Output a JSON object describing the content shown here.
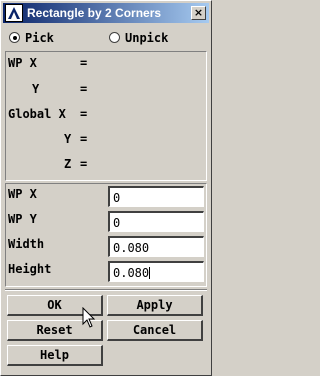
{
  "window": {
    "title": "Rectangle by 2 Corners",
    "close_glyph": "×"
  },
  "pick_mode": {
    "options": [
      "Pick",
      "Unpick"
    ],
    "selected": "Pick"
  },
  "readouts": [
    {
      "label": "WP X",
      "sep": "="
    },
    {
      "label": "Y",
      "sep": "="
    },
    {
      "label": "Global X",
      "sep": "="
    },
    {
      "label": "Y",
      "sep": "="
    },
    {
      "label": "Z",
      "sep": "="
    }
  ],
  "fields": [
    {
      "label": "WP X",
      "value": "0"
    },
    {
      "label": "WP Y",
      "value": "0"
    },
    {
      "label": "Width",
      "value": "0.080"
    },
    {
      "label": "Height",
      "value": "0.080"
    }
  ],
  "buttons": {
    "ok": "OK",
    "apply": "Apply",
    "reset": "Reset",
    "cancel": "Cancel",
    "help": "Help"
  },
  "icons": {
    "app": "ansys-logo-icon",
    "pointer": "mouse-pointer-icon"
  }
}
